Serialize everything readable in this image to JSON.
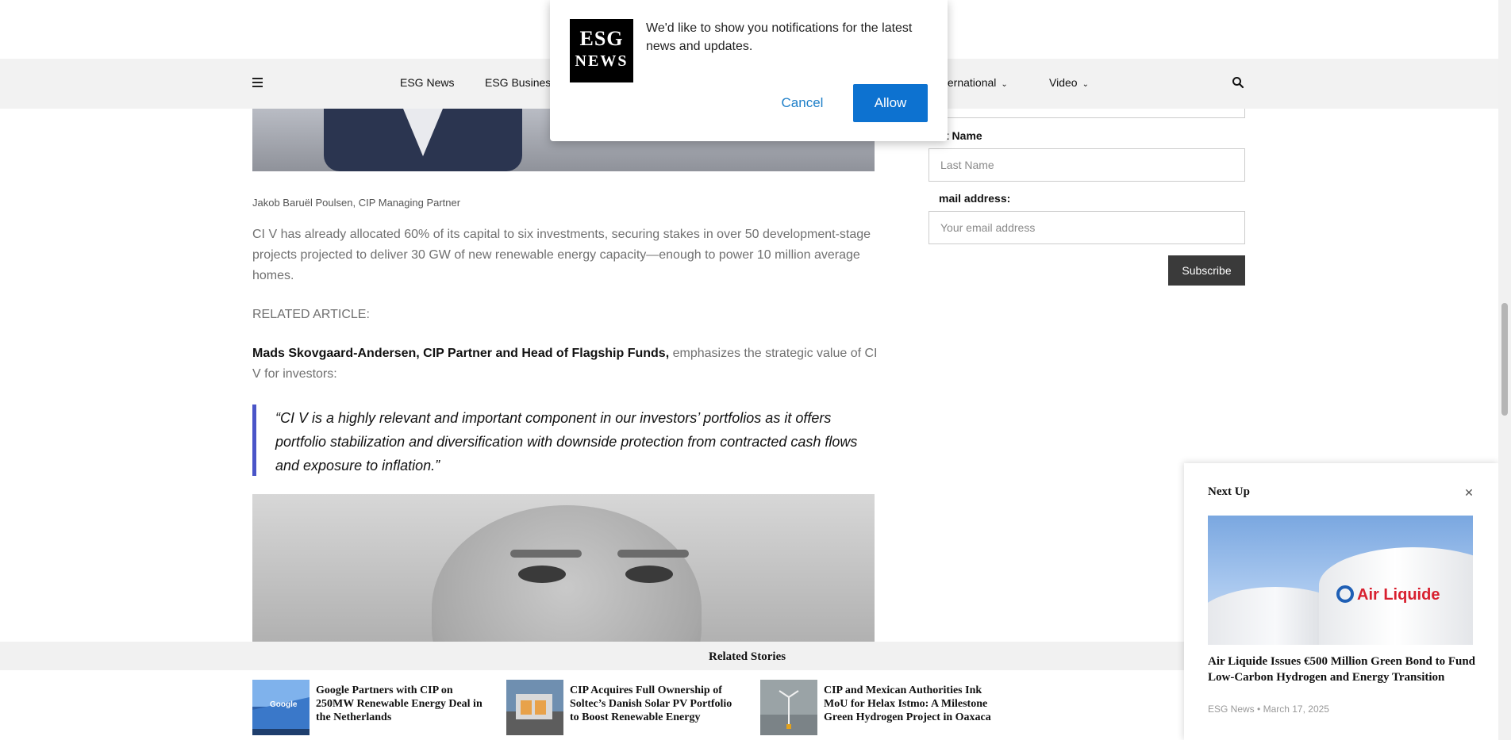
{
  "nav": {
    "items": [
      {
        "label": "ESG News",
        "dropdown": false
      },
      {
        "label": "ESG Business",
        "dropdown": false
      },
      {
        "label": "International",
        "visible_label": "ternational",
        "dropdown": true
      },
      {
        "label": "Video",
        "dropdown": true
      }
    ],
    "menu_icon": "hamburger-icon",
    "search_icon": "search-icon"
  },
  "article": {
    "caption": "Jakob Baruël Poulsen, CIP Managing Partner",
    "para1": "CI V has already allocated 60% of its capital to six investments, securing stakes in over 50 development-stage projects projected to deliver 30 GW of new renewable energy capacity—enough to power 10 million average homes.",
    "related_label": "RELATED ARTICLE:",
    "para2_bold": "Mads Skovgaard-Andersen, CIP Partner and Head of Flagship Funds,",
    "para2_rest": " emphasizes the strategic value of CI V for investors:",
    "quote": "“CI V is a highly relevant and important component in our investors’ portfolios as it offers portfolio stabilization and diversification with downside protection from contracted cash flows and exposure to inflation.”",
    "quote_bar_color": "#4a55c8"
  },
  "form": {
    "last_name_label": "Last Name",
    "last_name_label_visible": "t Name",
    "last_name_placeholder": "Last Name",
    "email_label": "Email address:",
    "email_label_visible": "mail address:",
    "email_placeholder": "Your email address",
    "subscribe_label": "Subscribe"
  },
  "notification": {
    "logo_line1": "ESG",
    "logo_line2": "NEWS",
    "message": "We'd like to show you notifications for the latest news and updates.",
    "cancel_label": "Cancel",
    "allow_label": "Allow",
    "allow_color": "#0d72d0"
  },
  "related": {
    "title": "Related Stories",
    "items": [
      {
        "title": "Google Partners with CIP on 250MW Renewable Energy Deal in the Netherlands"
      },
      {
        "title": "CIP Acquires Full Ownership of Soltec’s Danish Solar PV Portfolio to Boost Renewable Energy"
      },
      {
        "title": "CIP and Mexican Authorities Ink MoU for Helax Istmo: A Milestone Green Hydrogen Project in Oaxaca"
      }
    ]
  },
  "next_up": {
    "title": "Next Up",
    "close_icon": "close-icon",
    "image_brand": "Air Liquide",
    "headline": "Air Liquide Issues €500 Million Green Bond to Fund Low-Carbon Hydrogen and Energy Transition",
    "source": "ESG News",
    "separator": "•",
    "date": "March 17, 2025"
  }
}
